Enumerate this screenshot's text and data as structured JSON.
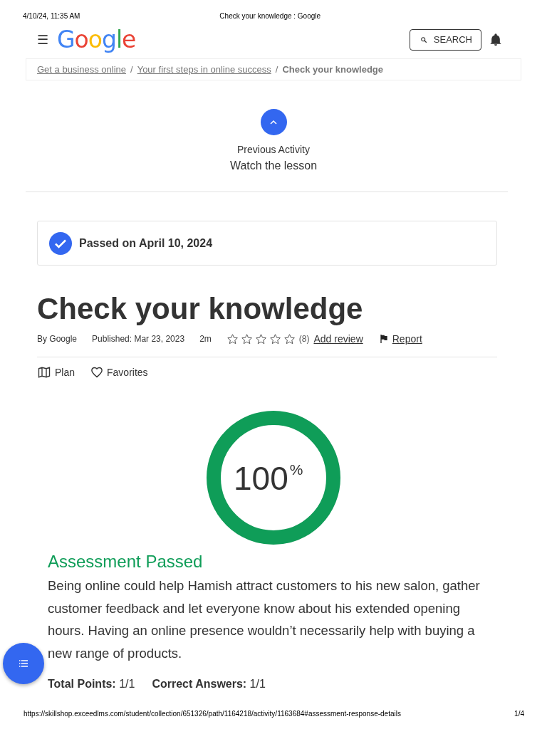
{
  "print_header": {
    "datetime": "4/10/24, 11:35 AM",
    "title": "Check your knowledge : Google"
  },
  "header": {
    "menu_icon": "☰",
    "logo": "Google",
    "search_button": "SEARCH"
  },
  "breadcrumbs": [
    {
      "label": "Get a business online",
      "link": true
    },
    {
      "label": "Your first steps in online success",
      "link": true
    },
    {
      "label": "Check your knowledge",
      "link": false
    }
  ],
  "breadcrumb_separator": "/",
  "previous_activity": {
    "label": "Previous Activity",
    "title": "Watch the lesson"
  },
  "status_card": {
    "text": "Passed on April 10, 2024",
    "passed": true
  },
  "title": "Check your knowledge",
  "meta": {
    "author": "By Google",
    "published": "Published: Mar 23, 2023",
    "duration": "2m",
    "stars": 0,
    "review_count": "(8)",
    "add_review": "Add review",
    "report": "Report"
  },
  "actions": [
    {
      "kind": "plan",
      "label": "Plan"
    },
    {
      "kind": "favorites",
      "label": "Favorites"
    }
  ],
  "score": {
    "level": 1,
    "value": "100",
    "unit": "%"
  },
  "result": {
    "heading": "Assessment Passed",
    "text": "Being online could help Hamish attract customers to his new salon, gather customer feedback and let everyone know about his extended opening hours. Having an online presence wouldn’t necessarily help with buying a new range of products."
  },
  "totals": [
    {
      "label": "Total Points:",
      "value": "1/1"
    },
    {
      "label": "Correct Answers:",
      "value": "1/1"
    }
  ],
  "print_footer": {
    "url": "https://skillshop.exceedlms.com/student/collection/651326/path/1164218/activity/1163684#assessment-response-details",
    "page": "1/4"
  }
}
